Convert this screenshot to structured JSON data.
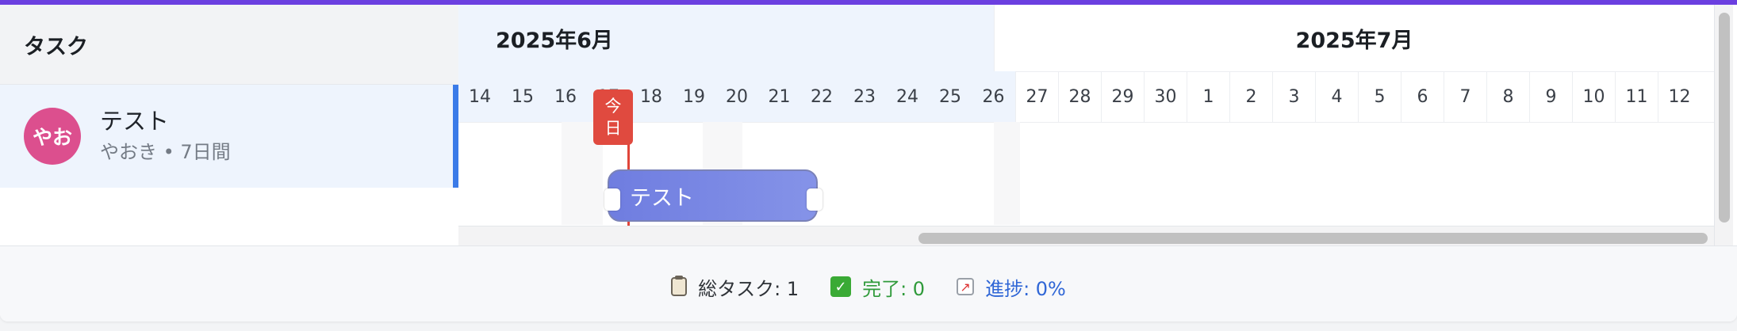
{
  "colors": {
    "accent": "#6b3fe0",
    "selected_row": "#eef4fd",
    "avatar": "#dc4f8e",
    "today": "#e04a3f",
    "task_bar": "#7a88e4",
    "done": "#2f9a3a",
    "progress": "#2f66d6"
  },
  "left": {
    "header": "タスク",
    "tasks": [
      {
        "avatar_text": "やお",
        "name": "テスト",
        "meta": "やおき • 7日間"
      }
    ]
  },
  "timeline": {
    "months": [
      {
        "label": "2025年6月"
      },
      {
        "label": "2025年7月"
      }
    ],
    "days": [
      "14",
      "15",
      "16",
      "17",
      "18",
      "19",
      "20",
      "21",
      "22",
      "23",
      "24",
      "25",
      "26",
      "27",
      "28",
      "29",
      "30",
      "1",
      "2",
      "3",
      "4",
      "5",
      "6",
      "7",
      "8",
      "9",
      "10",
      "11",
      "12"
    ],
    "today_label_1": "今",
    "today_label_2": "日",
    "bar_label": "テスト"
  },
  "footer": {
    "total": "総タスク: 1",
    "done": "完了: 0",
    "progress": "進捗: 0%",
    "icons": [
      "clipboard-icon",
      "check-icon",
      "chart-icon"
    ]
  }
}
